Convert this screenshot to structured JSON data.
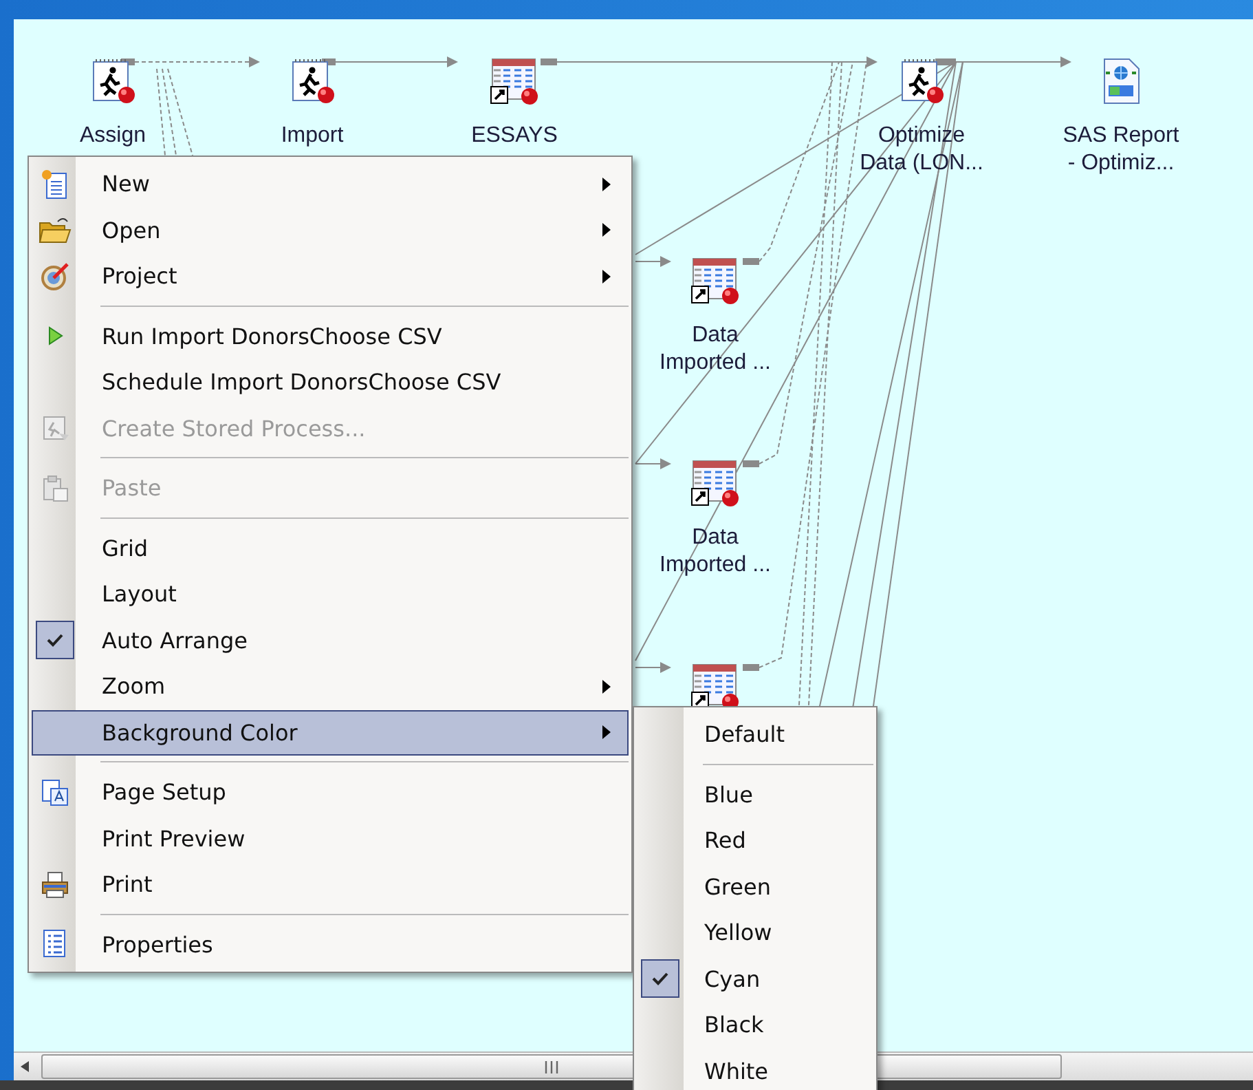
{
  "process_flow": {
    "nodes": [
      {
        "kind": "task",
        "label": "Assign"
      },
      {
        "kind": "task",
        "label": "Import"
      },
      {
        "kind": "table",
        "label": "ESSAYS"
      },
      {
        "kind": "task",
        "label": "Optimize\nData (LON..."
      },
      {
        "kind": "report",
        "label": "SAS Report\n- Optimiz..."
      },
      {
        "kind": "table",
        "label": "Data\nImported ..."
      },
      {
        "kind": "table",
        "label": "Data\nImported ..."
      },
      {
        "kind": "table"
      }
    ]
  },
  "context_menu": {
    "groups": [
      [
        {
          "label": "New",
          "has_submenu": true,
          "disabled": false,
          "checked": false,
          "selected": false
        },
        {
          "label": "Open",
          "has_submenu": true,
          "disabled": false,
          "checked": false,
          "selected": false
        },
        {
          "label": "Project",
          "has_submenu": true,
          "disabled": false,
          "checked": false,
          "selected": false
        }
      ],
      [
        {
          "label": "Run Import DonorsChoose CSV",
          "has_submenu": false,
          "disabled": false,
          "checked": false,
          "selected": false
        },
        {
          "label": "Schedule Import DonorsChoose CSV",
          "has_submenu": false,
          "disabled": false,
          "checked": false,
          "selected": false
        },
        {
          "label": "Create Stored Process...",
          "has_submenu": false,
          "disabled": true,
          "checked": false,
          "selected": false
        }
      ],
      [
        {
          "label": "Paste",
          "has_submenu": false,
          "disabled": true,
          "checked": false,
          "selected": false
        }
      ],
      [
        {
          "label": "Grid",
          "has_submenu": false,
          "disabled": false,
          "checked": false,
          "selected": false
        },
        {
          "label": "Layout",
          "has_submenu": false,
          "disabled": false,
          "checked": false,
          "selected": false
        },
        {
          "label": "Auto Arrange",
          "has_submenu": false,
          "disabled": false,
          "checked": true,
          "selected": false
        },
        {
          "label": "Zoom",
          "has_submenu": true,
          "disabled": false,
          "checked": false,
          "selected": false
        },
        {
          "label": "Background Color",
          "has_submenu": true,
          "disabled": false,
          "checked": false,
          "selected": true
        }
      ],
      [
        {
          "label": "Page Setup",
          "has_submenu": false,
          "disabled": false,
          "checked": false,
          "selected": false
        },
        {
          "label": "Print Preview",
          "has_submenu": false,
          "disabled": false,
          "checked": false,
          "selected": false
        },
        {
          "label": "Print",
          "has_submenu": false,
          "disabled": false,
          "checked": false,
          "selected": false
        }
      ],
      [
        {
          "label": "Properties",
          "has_submenu": false,
          "disabled": false,
          "checked": false,
          "selected": false
        }
      ]
    ]
  },
  "background_color_submenu": {
    "groups": [
      [
        {
          "label": "Default",
          "checked": false
        }
      ],
      [
        {
          "label": "Blue",
          "checked": false
        },
        {
          "label": "Red",
          "checked": false
        },
        {
          "label": "Green",
          "checked": false
        },
        {
          "label": "Yellow",
          "checked": false
        },
        {
          "label": "Cyan",
          "checked": true
        },
        {
          "label": "Black",
          "checked": false
        },
        {
          "label": "White",
          "checked": false
        }
      ]
    ]
  }
}
